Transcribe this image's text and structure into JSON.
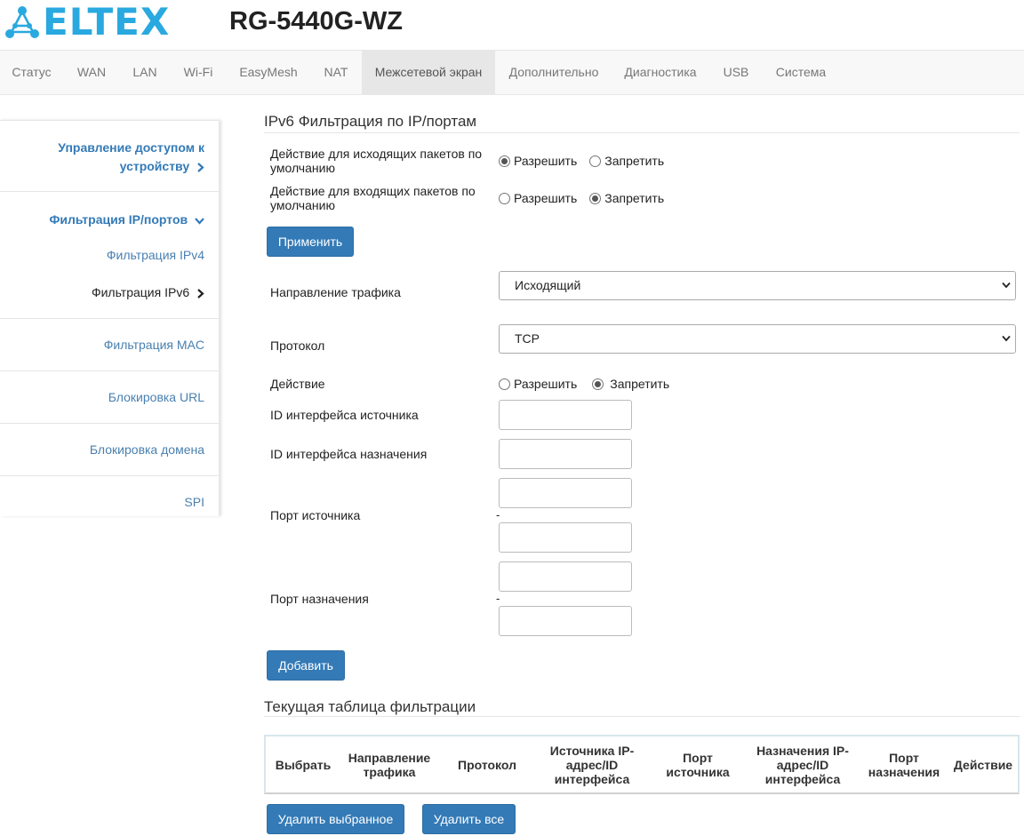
{
  "brand": {
    "logo_text": "ELTEX",
    "model": "RG-5440G-WZ",
    "color": "#29a9df"
  },
  "topnav": {
    "items": [
      "Статус",
      "WAN",
      "LAN",
      "Wi-Fi",
      "EasyMesh",
      "NAT",
      "Межсетевой экран",
      "Дополнительно",
      "Диагностика",
      "USB",
      "Система"
    ],
    "active_index": 6
  },
  "sidebar": {
    "access_control": [
      "Управление доступом к",
      "устройству"
    ],
    "ip_port_filter": "Фильтрация IP/портов",
    "ipv4_filter": "Фильтрация IPv4",
    "ipv6_filter": "Фильтрация IPv6",
    "mac_filter": "Фильтрация MAC",
    "url_block": "Блокировка URL",
    "domain_block": "Блокировка домена",
    "spi": "SPI"
  },
  "main": {
    "title": "IPv6 Фильтрация по IP/портам",
    "outgoing_default": {
      "label": [
        "Действие для исходящих пакетов по",
        "умолчанию"
      ],
      "allow": "Разрешить",
      "deny": "Запретить",
      "selected": "allow"
    },
    "incoming_default": {
      "label": [
        "Действие для входящих пакетов по",
        "умолчанию"
      ],
      "allow": "Разрешить",
      "deny": "Запретить",
      "selected": "deny"
    },
    "apply_button": "Применить",
    "traffic_direction": {
      "label": "Направление трафика",
      "value": "Исходящий"
    },
    "protocol": {
      "label": "Протокол",
      "value": "TCP"
    },
    "action": {
      "label": "Действие",
      "allow": "Разрешить",
      "deny": "Запретить",
      "selected": "deny"
    },
    "src_iface_id": {
      "label": "ID интерфейса источника",
      "value": ""
    },
    "dst_iface_id": {
      "label": "ID интерфейса назначения",
      "value": ""
    },
    "src_port": {
      "label": "Порт источника",
      "separator": "-",
      "from": "",
      "to": ""
    },
    "dst_port": {
      "label": "Порт назначения",
      "separator": "-",
      "from": "",
      "to": ""
    },
    "add_button": "Добавить",
    "table_title": "Текущая таблица фильтрации",
    "table_headers": [
      [
        "Выбрать"
      ],
      [
        "Направление",
        "трафика"
      ],
      [
        "Протокол"
      ],
      [
        "Источника IP-",
        "адрес/ID",
        "интерфейса"
      ],
      [
        "Порт",
        "источника"
      ],
      [
        "Назначения IP-",
        "адрес/ID",
        "интерфейса"
      ],
      [
        "Порт",
        "назначения"
      ],
      [
        "Действие"
      ]
    ],
    "delete_selected_button": "Удалить выбранное",
    "delete_all_button": "Удалить все"
  }
}
